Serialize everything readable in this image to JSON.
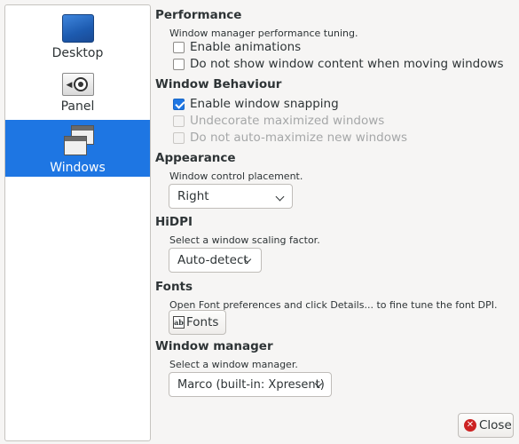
{
  "sidebar": {
    "items": [
      {
        "label": "Desktop",
        "icon": "desktop-icon",
        "active": false
      },
      {
        "label": "Panel",
        "icon": "panel-icon",
        "active": false
      },
      {
        "label": "Windows",
        "icon": "windows-icon",
        "active": true
      }
    ]
  },
  "performance": {
    "heading": "Performance",
    "description": "Window manager performance tuning.",
    "options": [
      {
        "label": "Enable animations",
        "checked": false,
        "enabled": true
      },
      {
        "label": "Do not show window content when moving windows",
        "checked": false,
        "enabled": true
      }
    ]
  },
  "behaviour": {
    "heading": "Window Behaviour",
    "options": [
      {
        "label": "Enable window snapping",
        "checked": true,
        "enabled": true
      },
      {
        "label": "Undecorate maximized windows",
        "checked": false,
        "enabled": false
      },
      {
        "label": "Do not auto-maximize new windows",
        "checked": false,
        "enabled": false
      }
    ]
  },
  "appearance": {
    "heading": "Appearance",
    "description": "Window control placement.",
    "selected": "Right"
  },
  "hidpi": {
    "heading": "HiDPI",
    "description": "Select a window scaling factor.",
    "selected": "Auto-detect"
  },
  "fonts": {
    "heading": "Fonts",
    "description": "Open Font preferences and click Details... to fine tune the font DPI.",
    "button_label": "Fonts"
  },
  "window_manager": {
    "heading": "Window manager",
    "description": "Select a window manager.",
    "selected": "Marco (built-in: Xpresent)"
  },
  "close_button_label": "Close",
  "colors": {
    "accent": "#1e76e3",
    "close_icon": "#cc2222"
  }
}
